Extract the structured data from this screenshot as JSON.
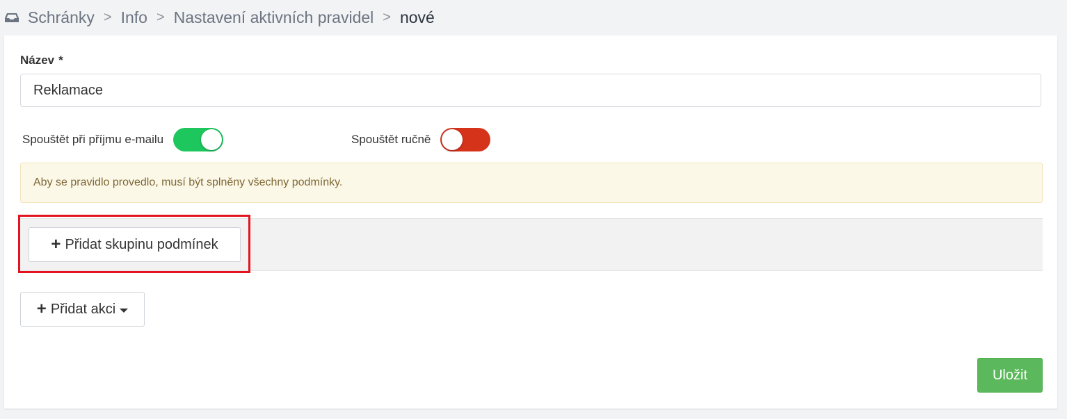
{
  "breadcrumb": {
    "icon": "inbox-icon",
    "items": [
      "Schránky",
      "Info",
      "Nastavení aktivních pravidel"
    ],
    "separator": ">",
    "current": "nové"
  },
  "form": {
    "name_label": "Název",
    "required_mark": "*",
    "name_value": "Reklamace",
    "toggle_on_email": {
      "label": "Spouštět při příjmu e-mailu",
      "state": "on",
      "color": "#1ec75e"
    },
    "toggle_manual": {
      "label": "Spouštět ručně",
      "state": "off",
      "color": "#d6331b"
    },
    "alert_text": "Aby se pravidlo provedlo, musí být splněny všechny podmínky.",
    "add_group_label": "Přidat skupinu podmínek",
    "add_action_label": "Přidat akci",
    "save_label": "Uložit"
  },
  "icons": {
    "plus": "plus-icon",
    "caret": "caret-down-icon"
  },
  "colors": {
    "highlight": "#e3141f",
    "save_button": "#5cb85c",
    "alert_bg": "#fcf8e8"
  }
}
